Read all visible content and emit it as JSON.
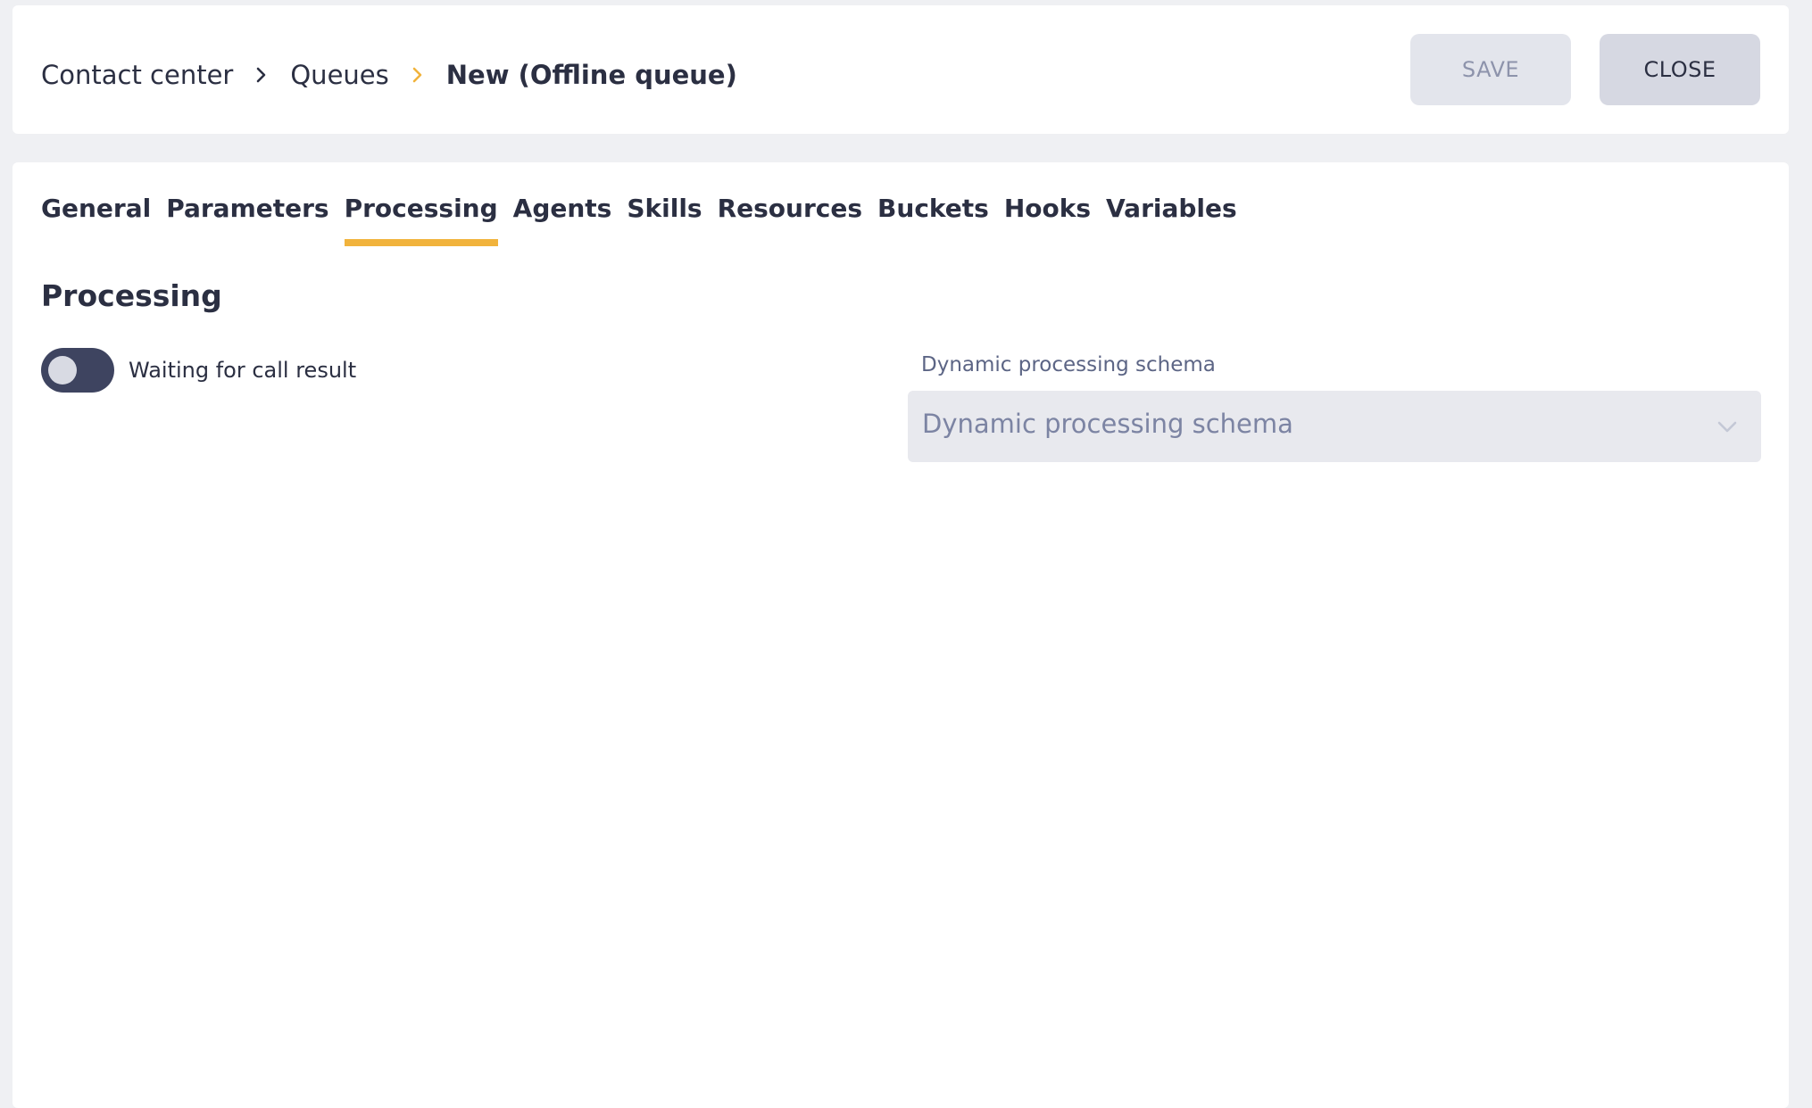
{
  "breadcrumb": {
    "items": [
      "Contact center",
      "Queues"
    ],
    "current": "New (Offline queue)",
    "separator_color": "#2b2f42",
    "active_separator_color": "#f1b33c"
  },
  "header": {
    "save_label": "SAVE",
    "close_label": "CLOSE"
  },
  "tabs": [
    {
      "label": "General",
      "active": false
    },
    {
      "label": "Parameters",
      "active": false
    },
    {
      "label": "Processing",
      "active": true
    },
    {
      "label": "Agents",
      "active": false
    },
    {
      "label": "Skills",
      "active": false
    },
    {
      "label": "Resources",
      "active": false
    },
    {
      "label": "Buckets",
      "active": false
    },
    {
      "label": "Hooks",
      "active": false
    },
    {
      "label": "Variables",
      "active": false
    }
  ],
  "section": {
    "title": "Processing"
  },
  "toggle": {
    "label": "Waiting for call result",
    "checked": false
  },
  "dynamic_schema": {
    "label": "Dynamic processing schema",
    "placeholder": "Dynamic processing schema"
  },
  "colors": {
    "accent": "#f1b33c",
    "text": "#2b2f42",
    "background": "#eff0f3"
  }
}
